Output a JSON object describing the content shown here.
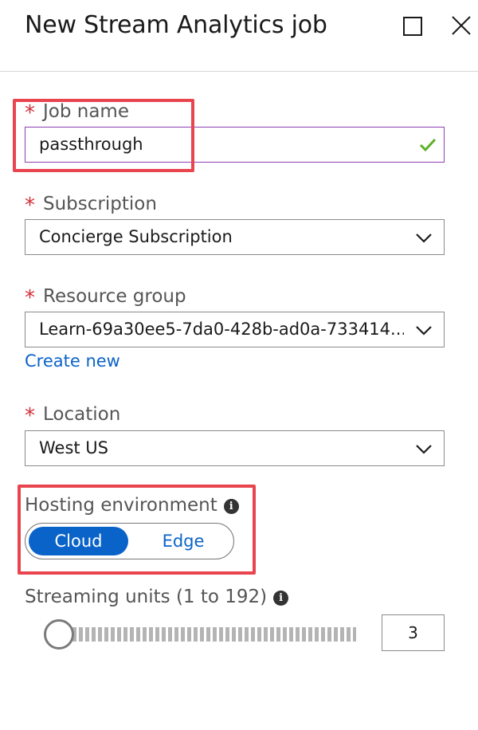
{
  "header": {
    "title": "New Stream Analytics job"
  },
  "form": {
    "required_marker": "*",
    "job_name": {
      "label": "Job name",
      "value": "passthrough"
    },
    "subscription": {
      "label": "Subscription",
      "value": "Concierge Subscription"
    },
    "resource_group": {
      "label": "Resource group",
      "value": "Learn-69a30ee5-7da0-428b-ad0a-733414...",
      "create_new": "Create new"
    },
    "location": {
      "label": "Location",
      "value": "West US"
    },
    "hosting_environment": {
      "label": "Hosting environment",
      "info": "i",
      "options": [
        "Cloud",
        "Edge"
      ],
      "selected": "Cloud"
    },
    "streaming_units": {
      "label": "Streaming units (1 to 192)",
      "info": "i",
      "value": "3",
      "min": 1,
      "max": 192
    }
  },
  "colors": {
    "accent": "#0a63c9",
    "required": "#d2303a",
    "valid_check": "#5bb125",
    "focus_border": "#8e3fb5",
    "highlight_box": "#e8454f"
  },
  "icons": {
    "maximize": "maximize-icon",
    "close": "close-icon",
    "dropdown": "chevron-down-icon",
    "valid": "checkmark-icon",
    "info": "info-icon"
  }
}
